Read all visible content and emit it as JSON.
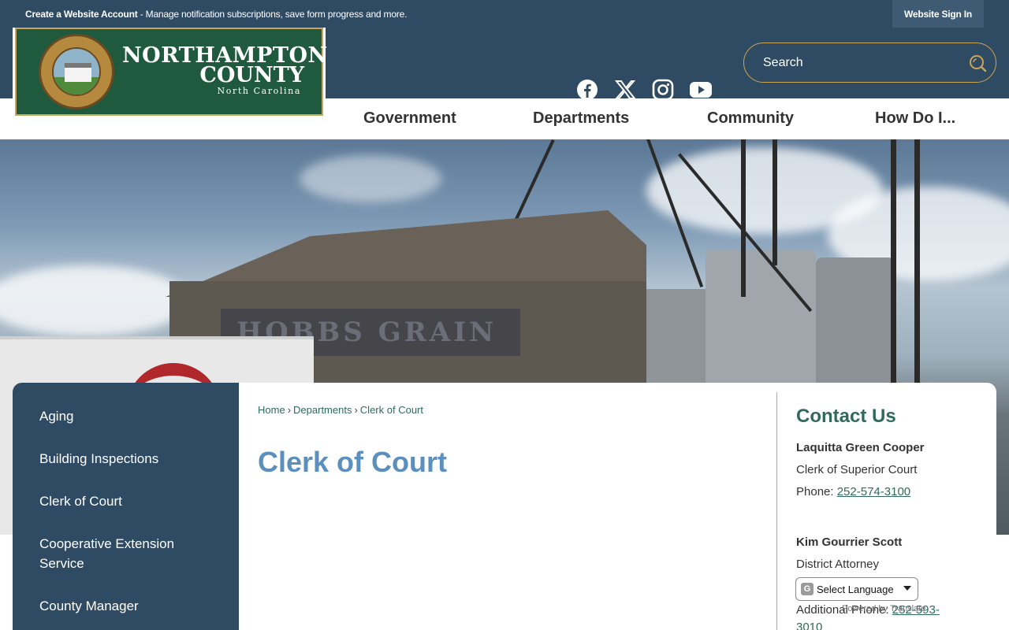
{
  "topbar": {
    "create_account": "Create a Website Account",
    "message": " - Manage notification subscriptions, save form progress and more.",
    "signin_label": "Website Sign In"
  },
  "logo": {
    "title_line1": "NORTHAMPTON",
    "title_line2": "COUNTY",
    "subtitle": "North Carolina"
  },
  "social": [
    "facebook-icon",
    "x-icon",
    "instagram-icon",
    "youtube-icon"
  ],
  "search": {
    "placeholder": "Search"
  },
  "nav": {
    "items": [
      {
        "label": "Government"
      },
      {
        "label": "Departments"
      },
      {
        "label": "Community"
      },
      {
        "label": "How Do I..."
      }
    ]
  },
  "hero": {
    "sign_text": "HOBBS GRAIN"
  },
  "sidebar": {
    "items": [
      {
        "label": "Aging"
      },
      {
        "label": "Building Inspections"
      },
      {
        "label": "Clerk of Court"
      },
      {
        "label": "Cooperative Extension Service"
      },
      {
        "label": "County Manager"
      }
    ]
  },
  "breadcrumb": {
    "items": [
      "Home",
      "Departments",
      "Clerk of Court"
    ],
    "separator": "›"
  },
  "page": {
    "title": "Clerk of Court"
  },
  "contact": {
    "title": "Contact Us",
    "people": [
      {
        "name": "Laquitta Green Cooper",
        "role": "Clerk of Superior Court",
        "phone_label": "Phone: ",
        "phone": "252-574-3100"
      },
      {
        "name": "Kim Gourrier Scott",
        "role": "District Attorney",
        "additional_label": "Additional Phone: ",
        "additional_phone": "252-593-3010"
      }
    ]
  },
  "translate": {
    "select_label": "Select Language",
    "powered": "Powered by Translate"
  },
  "colors": {
    "header": "#2f4a63",
    "accent_gold": "#c9a65a",
    "title_blue": "#5b8fbd",
    "link_green": "#2f6a5a"
  }
}
